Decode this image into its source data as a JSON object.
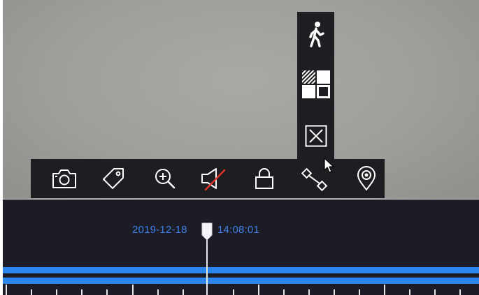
{
  "playback": {
    "date": "2019-12-18",
    "time": "14:08:01"
  },
  "toolbar": {
    "vertical": [
      {
        "icon": "person-walking-icon"
      },
      {
        "icon": "mosaic-grid-icon"
      },
      {
        "icon": "close-box-icon"
      }
    ],
    "horizontal": [
      {
        "icon": "camera-icon"
      },
      {
        "icon": "tag-icon"
      },
      {
        "icon": "zoom-in-icon"
      },
      {
        "icon": "speaker-muted-icon"
      },
      {
        "icon": "lock-icon"
      },
      {
        "icon": "ptz-link-icon"
      },
      {
        "icon": "location-pin-icon"
      }
    ]
  },
  "colors": {
    "toolbar_bg": "#1e1e22",
    "timeline_bg": "#1c1c26",
    "accent_blue": "#2b86f0",
    "mute_slash": "#e0342a"
  }
}
